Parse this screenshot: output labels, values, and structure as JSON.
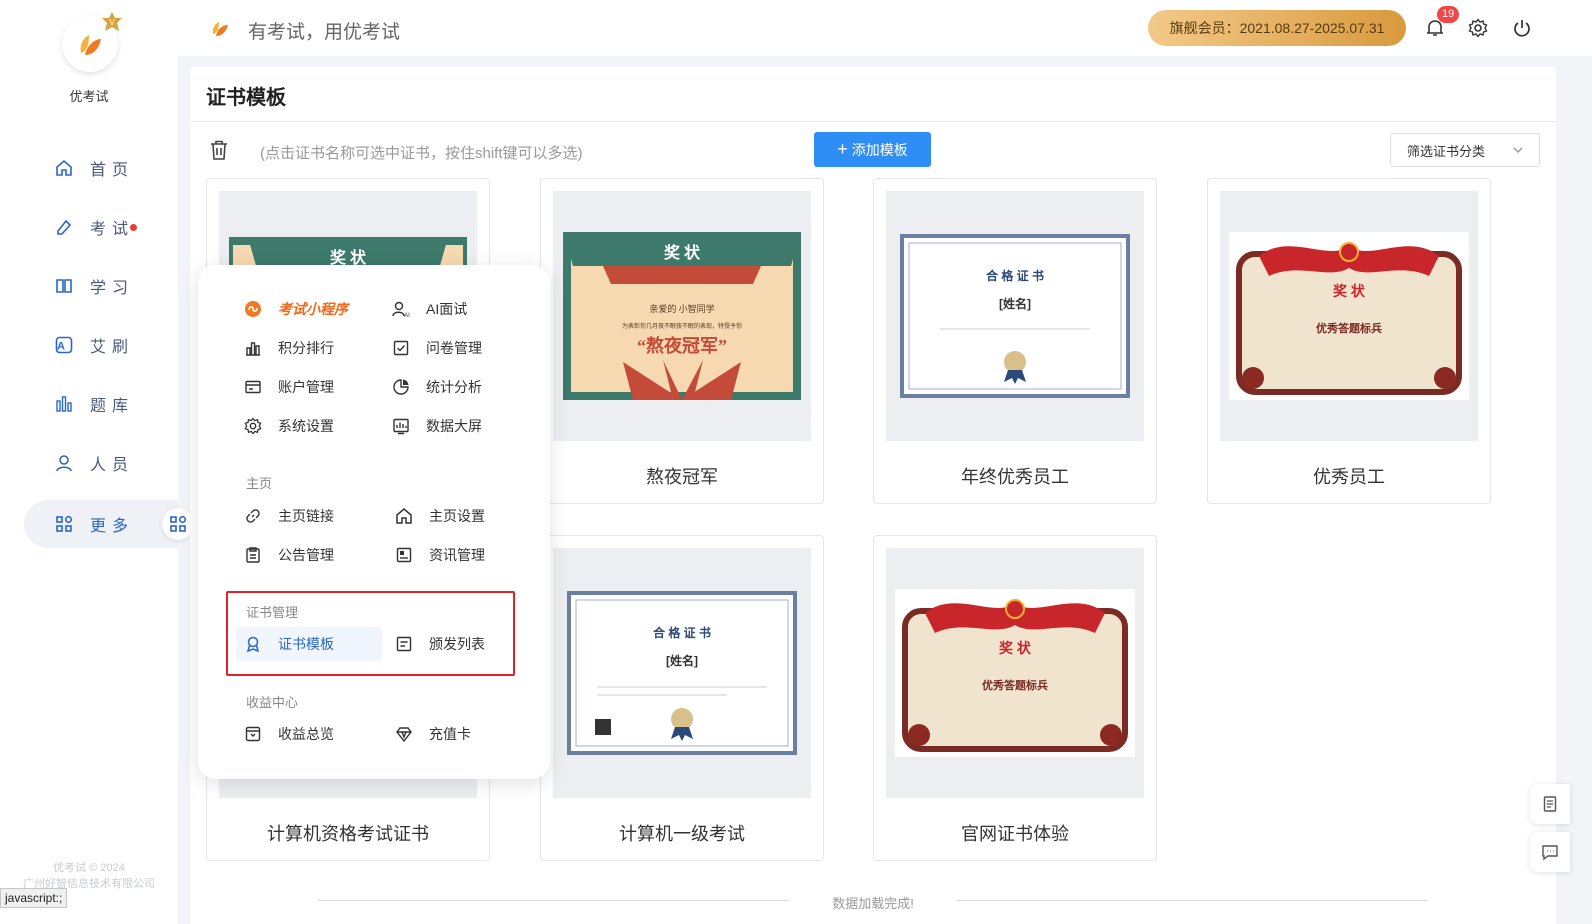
{
  "app": {
    "name": "优考试",
    "slogan": "有考试，用优考试",
    "member": "旗舰会员：2021.08.27-2025.07.31",
    "notifications": "19",
    "copyright_line1": "优考试 © 2024",
    "copyright_line2": "广州好智信息技术有限公司",
    "status_text": "javascript:;"
  },
  "sidebar": {
    "items": [
      {
        "label": "首页",
        "icon": "home-icon"
      },
      {
        "label": "考试",
        "icon": "exam-icon"
      },
      {
        "label": "学习",
        "icon": "book-icon"
      },
      {
        "label": "艾刷",
        "icon": "a-letter-icon"
      },
      {
        "label": "题库",
        "icon": "bars-icon"
      },
      {
        "label": "人员",
        "icon": "user-icon"
      },
      {
        "label": "更多",
        "icon": "grid-icon"
      }
    ]
  },
  "page": {
    "title": "证书模板",
    "hint": "(点击证书名称可选中证书，按住shift键可以多选)",
    "add_button": "添加模板",
    "filter_placeholder": "筛选证书分类",
    "loaded_text": "数据加载完成!"
  },
  "cards": [
    {
      "name": "",
      "style": "green"
    },
    {
      "name": "熬夜冠军",
      "style": "green"
    },
    {
      "name": "年终优秀员工",
      "style": "blue"
    },
    {
      "name": "优秀员工",
      "style": "red"
    },
    {
      "name": "计算机资格考试证书",
      "style": "hidden"
    },
    {
      "name": "计算机一级考试",
      "style": "blue2"
    },
    {
      "name": "官网证书体验",
      "style": "red2"
    }
  ],
  "cert_text": {
    "award": "奖 状",
    "dear": "亲爱的 小智同学",
    "line": "为表彰你几月夜不眠夜不眠的表现，特授予你",
    "champion": "“熬夜冠军”",
    "pass": "合 格 证 书",
    "name_ph": "[姓名]",
    "red_award": "奖 状",
    "best": "优秀答题标兵"
  },
  "menu": {
    "items_top": [
      "考试小程序",
      "AI面试",
      "积分排行",
      "问卷管理",
      "账户管理",
      "统计分析",
      "系统设置",
      "数据大屏"
    ],
    "section_home": "主页",
    "items_home": [
      "主页链接",
      "主页设置",
      "公告管理",
      "资讯管理"
    ],
    "section_cert": "证书管理",
    "items_cert": [
      "证书模板",
      "颁发列表"
    ],
    "section_income": "收益中心",
    "items_income": [
      "收益总览",
      "充值卡"
    ]
  },
  "colors": {
    "primary": "#2f8ef5",
    "active_text": "#2b66c9",
    "highlight_border": "#e0222a",
    "orange": "#f06a1c"
  }
}
